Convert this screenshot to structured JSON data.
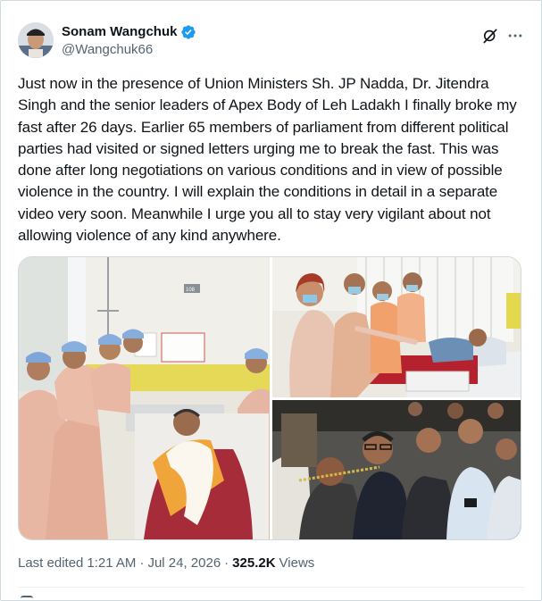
{
  "author": {
    "display_name": "Sonam Wangchuk",
    "handle": "@Wangchuk66",
    "verified": true,
    "verified_color": "#1d9bf0"
  },
  "icons": {
    "verified": "verified-badge-icon",
    "grok": "grok-icon",
    "more": "more-options-icon",
    "reply": "reply-icon"
  },
  "tweet": {
    "text": "Just now in the presence of Union Ministers Sh. JP Nadda, Dr. Jitendra Singh and the senior leaders of Apex Body of Leh Ladakh I finally broke my fast after 26 days. Earlier 65 members of parliament from different political parties had visited or signed letters urging me to break the fast. This was done after long negotiations on various conditions and in view of possible violence in the country. I will explain the conditions in detail in a separate video very soon. Meanwhile I urge you all to stay very vigilant about not allowing violence of any kind anywhere."
  },
  "media": {
    "photo_count": 3,
    "room_number": "108"
  },
  "meta": {
    "edited_label": "Last edited",
    "time": "1:21 AM",
    "separator": "·",
    "date": "Jul 24, 2026",
    "views_count": "325.2K",
    "views_label": "Views"
  },
  "colors": {
    "text_primary": "#0f1419",
    "text_secondary": "#536471",
    "border": "#cfd9de"
  }
}
